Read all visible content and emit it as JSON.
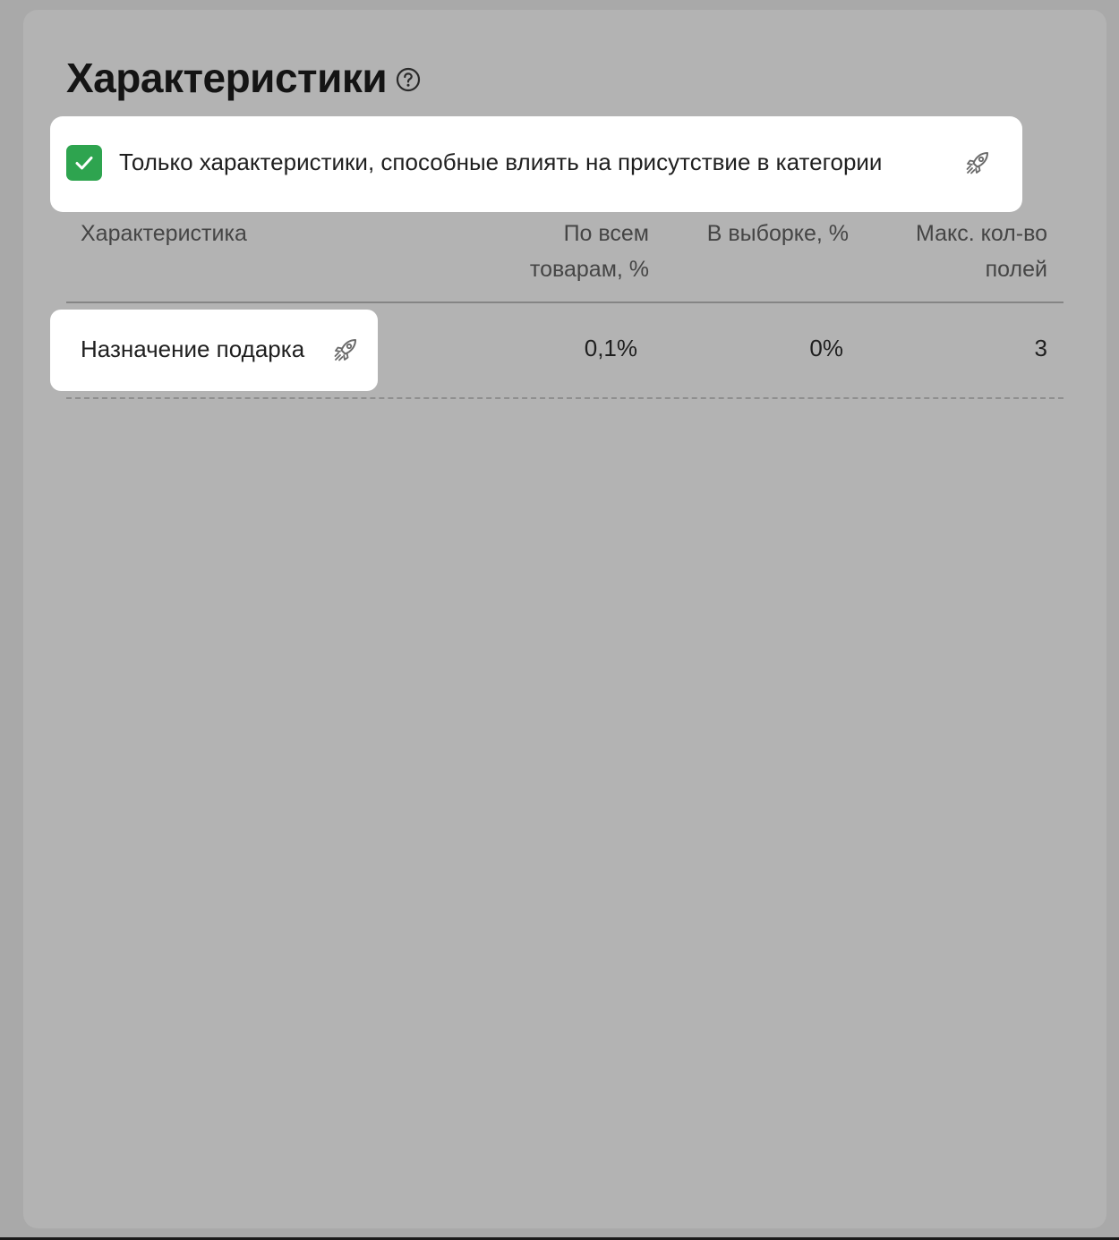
{
  "header": {
    "title": "Характеристики",
    "help_icon": "question-circle-icon"
  },
  "filter": {
    "checked": true,
    "label": "Только характеристики, способные влиять на присутствие в категории",
    "icon": "rocket-icon",
    "accent_color": "#2ea44f"
  },
  "table": {
    "columns": [
      "Характеристика",
      "По всем товарам, %",
      "В выборке, %",
      "Макс. кол-во полей"
    ],
    "rows": [
      {
        "name": "Назначение подарка",
        "icon": "rocket-icon",
        "all_products": "0,1%",
        "in_sample": "0%",
        "max_fields": "3"
      }
    ]
  }
}
